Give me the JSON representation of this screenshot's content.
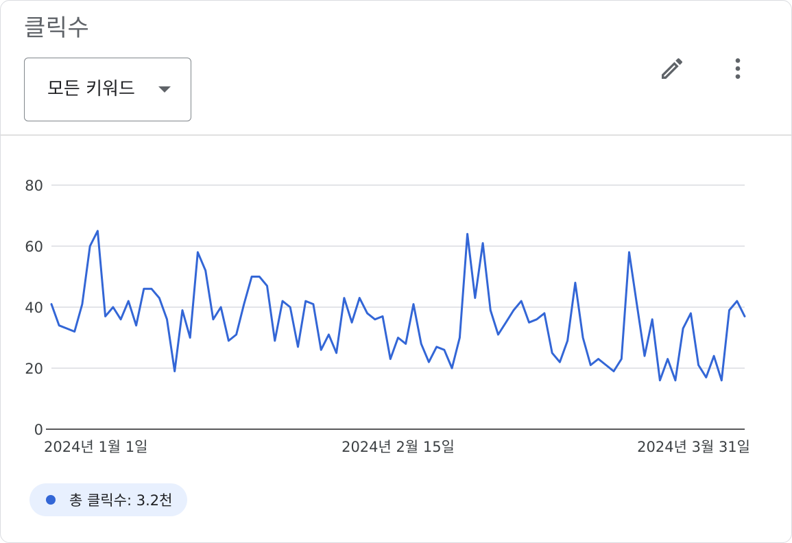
{
  "card": {
    "title": "클릭수",
    "dropdown_label": "모든 키워드"
  },
  "icons": {
    "edit": "pencil-icon",
    "more": "more-vert-icon",
    "dropdown": "arrow-drop-down-icon"
  },
  "legend": {
    "label": "총 클릭수: 3.2천",
    "color": "#3366d6"
  },
  "colors": {
    "series": "#3366d6",
    "grid": "#dadce0",
    "axis": "#3c4043"
  },
  "chart_data": {
    "type": "line",
    "ylim": [
      0,
      80
    ],
    "yticks": [
      "0",
      "20",
      "40",
      "60",
      "80"
    ],
    "xlim": [
      "2024-01-01",
      "2024-03-31"
    ],
    "x_tick_labels": [
      {
        "date": "2024-01-01",
        "label": "2024년 1월 1일"
      },
      {
        "date": "2024-02-15",
        "label": "2024년 2월 15일"
      },
      {
        "date": "2024-03-31",
        "label": "2024년 3월 31일"
      }
    ],
    "grid": true,
    "legend_position": "bottom-left",
    "series": [
      {
        "name": "총 클릭수",
        "x": [
          "2024-01-01",
          "2024-01-02",
          "2024-01-03",
          "2024-01-04",
          "2024-01-05",
          "2024-01-06",
          "2024-01-07",
          "2024-01-08",
          "2024-01-09",
          "2024-01-10",
          "2024-01-11",
          "2024-01-12",
          "2024-01-13",
          "2024-01-14",
          "2024-01-15",
          "2024-01-16",
          "2024-01-17",
          "2024-01-18",
          "2024-01-19",
          "2024-01-20",
          "2024-01-21",
          "2024-01-22",
          "2024-01-23",
          "2024-01-24",
          "2024-01-25",
          "2024-01-26",
          "2024-01-27",
          "2024-01-28",
          "2024-01-29",
          "2024-01-30",
          "2024-01-31",
          "2024-02-01",
          "2024-02-02",
          "2024-02-03",
          "2024-02-04",
          "2024-02-05",
          "2024-02-06",
          "2024-02-07",
          "2024-02-08",
          "2024-02-09",
          "2024-02-10",
          "2024-02-11",
          "2024-02-12",
          "2024-02-13",
          "2024-02-14",
          "2024-02-15",
          "2024-02-16",
          "2024-02-17",
          "2024-02-18",
          "2024-02-19",
          "2024-02-20",
          "2024-02-21",
          "2024-02-22",
          "2024-02-23",
          "2024-02-24",
          "2024-02-25",
          "2024-02-26",
          "2024-02-27",
          "2024-02-28",
          "2024-02-29",
          "2024-03-01",
          "2024-03-02",
          "2024-03-03",
          "2024-03-04",
          "2024-03-05",
          "2024-03-06",
          "2024-03-07",
          "2024-03-08",
          "2024-03-09",
          "2024-03-10",
          "2024-03-11",
          "2024-03-12",
          "2024-03-13",
          "2024-03-14",
          "2024-03-15",
          "2024-03-16",
          "2024-03-17",
          "2024-03-18",
          "2024-03-19",
          "2024-03-20",
          "2024-03-21",
          "2024-03-22",
          "2024-03-23",
          "2024-03-24",
          "2024-03-25",
          "2024-03-26",
          "2024-03-27",
          "2024-03-28",
          "2024-03-29",
          "2024-03-30",
          "2024-03-31"
        ],
        "values": [
          41,
          34,
          33,
          32,
          41,
          60,
          65,
          37,
          40,
          36,
          42,
          34,
          46,
          46,
          43,
          36,
          19,
          39,
          30,
          58,
          52,
          36,
          40,
          29,
          31,
          41,
          50,
          50,
          47,
          29,
          42,
          40,
          27,
          42,
          41,
          26,
          31,
          25,
          43,
          35,
          43,
          38,
          36,
          37,
          23,
          30,
          28,
          41,
          28,
          22,
          27,
          26,
          20,
          30,
          64,
          43,
          61,
          39,
          31,
          35,
          39,
          42,
          35,
          36,
          38,
          25,
          22,
          29,
          48,
          30,
          21,
          23,
          21,
          19,
          23,
          58,
          41,
          24,
          36,
          16,
          23,
          16,
          33,
          38,
          21,
          17,
          24,
          16,
          39,
          42,
          37
        ]
      }
    ]
  }
}
